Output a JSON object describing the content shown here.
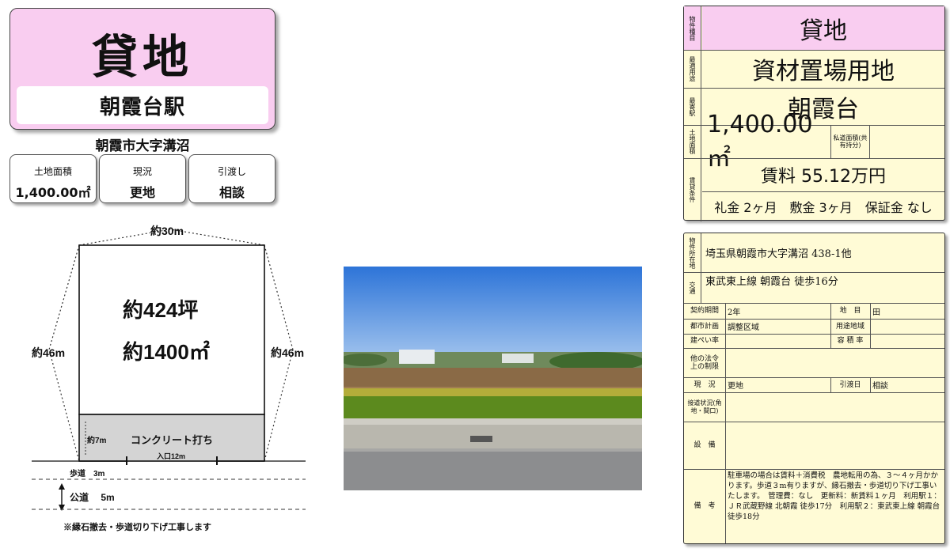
{
  "header": {
    "type": "貸地",
    "station": "朝霞台駅",
    "address": "朝霞市大字溝沼"
  },
  "tiles": [
    {
      "label": "土地面積",
      "value": "1,400.00㎡"
    },
    {
      "label": "現況",
      "value": "更地"
    },
    {
      "label": "引渡し",
      "value": "相談"
    }
  ],
  "diagram": {
    "top": "約30m",
    "left": "約46m",
    "right": "約46m",
    "tsubo": "約424坪",
    "sqm": "約1400㎡",
    "concrete": "コンクリート打ち",
    "depth": "約7m",
    "entrance": "入口12m",
    "sidewalk": "歩道　3m",
    "road": "公道　 5m",
    "note": "※縁石撤去・歩道切り下げ工事します"
  },
  "summary": {
    "kind_h": "物件種目",
    "kind": "貸地",
    "use_h": "最適用途",
    "use": "資材置場用地",
    "station_h": "最寄駅",
    "station": "朝霞台",
    "area_h": "土地面積",
    "area": "1,400.00㎡",
    "private_road_h": "私道面積(共有持分)",
    "private_road": "",
    "rent_h": "賃貸条件",
    "rent": "賃料 55.12万円",
    "terms": "礼金 2ヶ月　敷金 3ヶ月　保証金 なし"
  },
  "details": {
    "location_h": "物件所在地",
    "location": "埼玉県朝霞市大字溝沼 438-1他",
    "access_h": "交通",
    "access": "東武東上線 朝霞台 徒歩16分",
    "contract_h": "契約期間",
    "contract": "2年",
    "chimoku_h": "地　目",
    "chimoku": "田",
    "city_plan_h": "都市計画",
    "city_plan": "調整区域",
    "zoning_h": "用途地域",
    "zoning": "",
    "kenpei_h": "建ぺい率",
    "kenpei": "",
    "yoseki_h": "容 積 率",
    "yoseki": "",
    "law_h": "他の法令上の制限",
    "law": "",
    "status_h": "現　況",
    "status": "更地",
    "handover_h": "引渡日",
    "handover": "相談",
    "road_h": "接道状況(角地・間口)",
    "road": "",
    "facility_h": "設　備",
    "facility": "",
    "remarks_h": "備　考",
    "remarks": "駐車場の場合は賃料＋消費税　農地転用の為、３～４ヶ月かかります。歩道３m有りますが、縁石撤去・歩道切り下げ工事いたします。　管理費：なし　更新料：新賃料１ヶ月　利用駅１：ＪＲ武蔵野線 北朝霞 徒歩17分　利用駅２：東武東上線 朝霞台 徒歩18分"
  }
}
